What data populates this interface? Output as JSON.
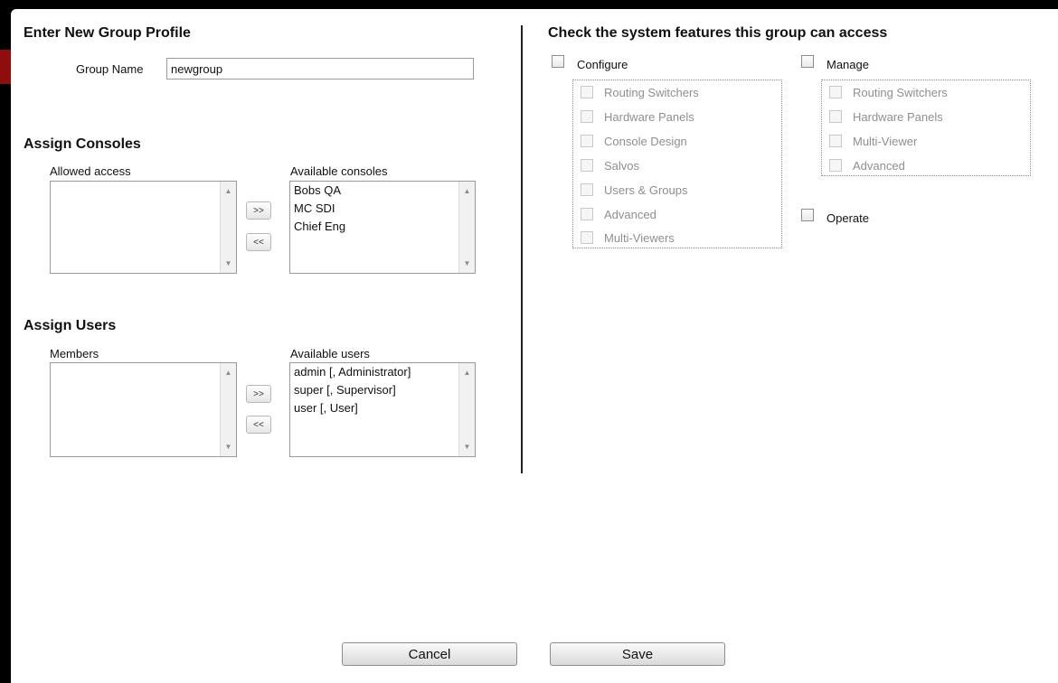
{
  "profile": {
    "title": "Enter New Group Profile",
    "group_name_label": "Group Name",
    "group_name_value": "newgroup"
  },
  "consoles": {
    "title": "Assign Consoles",
    "allowed_label": "Allowed access",
    "available_label": "Available consoles",
    "allowed_items": [],
    "available_items": [
      "Bobs QA",
      "MC SDI",
      "Chief Eng"
    ],
    "add_button": ">>",
    "remove_button": "<<"
  },
  "users": {
    "title": "Assign Users",
    "members_label": "Members",
    "available_label": "Available users",
    "members_items": [],
    "available_items": [
      "admin [, Administrator]",
      "super [, Supervisor]",
      "user [, User]"
    ],
    "add_button": ">>",
    "remove_button": "<<"
  },
  "features": {
    "title": "Check the system features this group can access",
    "configure": {
      "label": "Configure",
      "checked": false,
      "items": [
        "Routing Switchers",
        "Hardware Panels",
        "Console Design",
        "Salvos",
        "Users & Groups",
        "Advanced",
        "Multi-Viewers"
      ]
    },
    "manage": {
      "label": "Manage",
      "checked": false,
      "items": [
        "Routing Switchers",
        "Hardware Panels",
        "Multi-Viewer",
        "Advanced"
      ]
    },
    "operate": {
      "label": "Operate",
      "checked": false
    }
  },
  "actions": {
    "cancel_label": "Cancel",
    "save_label": "Save"
  },
  "icons": {
    "scroll_up": "triangle-up-icon",
    "scroll_down": "triangle-down-icon"
  }
}
